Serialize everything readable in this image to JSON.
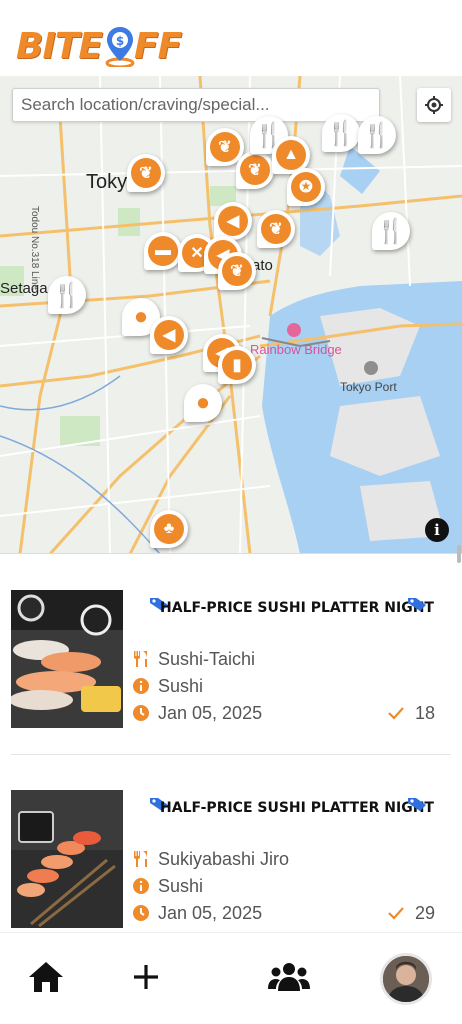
{
  "app": {
    "logo_text_left": "BITE",
    "logo_text_right": "FF"
  },
  "map": {
    "search_placeholder": "Search location/craving/special...",
    "labels": {
      "tokyo": "Toky",
      "setagaya": "Setaga",
      "minato": "ato",
      "rainbow_bridge": "Rainbow Bridge",
      "tokyo_port": "Tokyo Port",
      "todoroki_line": "Todou No.318 Line"
    },
    "accent_color": "#ef8a2b"
  },
  "deals": [
    {
      "title": "HALF-PRICE SUSHI PLATTER NIGHT",
      "restaurant": "Sushi-Taichi",
      "category": "Sushi",
      "date": "Jan 05, 2025",
      "count": "18"
    },
    {
      "title": "HALF-PRICE SUSHI PLATTER NIGHT",
      "restaurant": "Sukiyabashi Jiro",
      "category": "Sushi",
      "date": "Jan 05, 2025",
      "count": "29"
    }
  ],
  "nav": {
    "items": [
      "home-icon",
      "plus-icon",
      "users-icon",
      "avatar"
    ]
  }
}
